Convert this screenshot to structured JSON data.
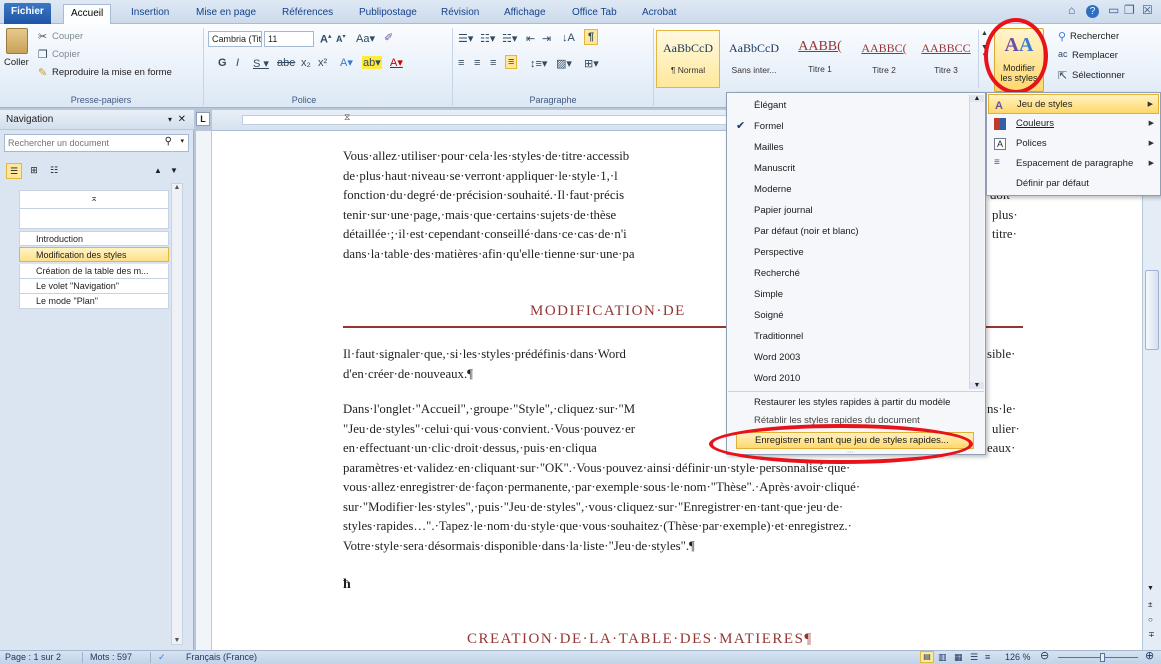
{
  "tabs": [
    "Fichier",
    "Accueil",
    "Insertion",
    "Mise en page",
    "Références",
    "Publipostage",
    "Révision",
    "Affichage",
    "Office Tab",
    "Acrobat"
  ],
  "clipboard": {
    "paste": "Coller",
    "cut": "Couper",
    "copy": "Copier",
    "format_painter": "Reproduire la mise en forme",
    "label": "Presse-papiers"
  },
  "font": {
    "name": "Cambria (Titre",
    "size": "11",
    "label": "Police"
  },
  "paragraph": {
    "label": "Paragraphe"
  },
  "styles": {
    "items": [
      {
        "preview": "AaBbCcD",
        "name": "¶ Normal"
      },
      {
        "preview": "AaBbCcD",
        "name": "Sans inter..."
      },
      {
        "preview": "AABB(",
        "name": "Titre 1"
      },
      {
        "preview": "AABBC(",
        "name": "Titre 2"
      },
      {
        "preview": "AABBCC",
        "name": "Titre 3"
      }
    ],
    "modify_line1": "Modifier",
    "modify_line2": "les styles"
  },
  "editing": {
    "find": "Rechercher",
    "replace": "Remplacer",
    "select": "Sélectionner"
  },
  "navigation": {
    "title": "Navigation",
    "search_placeholder": "Rechercher un document",
    "items": [
      "Introduction",
      "Modification des styles",
      "Création de la table des m...",
      "Le volet \"Navigation\"",
      "Le mode \"Plan\""
    ]
  },
  "document": {
    "para1": [
      "Vous·allez·utiliser·pour·cela·les·styles·de·titre·accessib",
      "de·plus·haut·niveau·se·verront·appliquer·le·style·1,·l",
      "fonction·du·degré·de·précision·souhaité.·Il·faut·précis",
      "tenir·sur·une·page,·mais·que·certains·sujets·de·thèse",
      "détaillée·;·il·est·cependant·conseillé·dans·ce·cas·de·n'i",
      "dans·la·table·des·matières·afin·qu'elle·tienne·sur·une·pa"
    ],
    "para1_right": [
      "doit·",
      "plus·",
      "titre·"
    ],
    "heading1": "MODIFICATION·DE",
    "para2": [
      "Il·faut·signaler·que,·si·les·styles·prédéfinis·dans·Word",
      "d'en·créer·de·nouveaux.¶"
    ],
    "para2_right": "sible·",
    "para3": [
      "Dans·l'onglet·\"Accueil\",·groupe·\"Style\",·cliquez·sur·\"M",
      "\"Jeu·de·styles\"·celui·qui·vous·convient.·Vous·pouvez·er",
      "en·effectuant·un·clic·droit·dessus,·puis·en·cliqua",
      "paramètres·et·validez·en·cliquant·sur·\"OK\".·Vous·pouvez·ainsi·définir·un·style·personnalisé·que·",
      "vous·allez·enregistrer·de·façon·permanente,·par·exemple·sous·le·nom·\"Thèse\".·Après·avoir·cliqué·",
      "sur·\"Modifier·les·styles\",·puis·\"Jeu·de·styles\",·vous·cliquez·sur·\"Enregistrer·en·tant·que·jeu·de·",
      "styles·rapides…\".·Tapez·le·nom·du·style·que·vous·souhaitez·(Thèse·par·exemple)·et·enregistrez.·",
      "Votre·style·sera·désormais·disponible·dans·la·liste·\"Jeu·de·styles\".¶"
    ],
    "para3_right": [
      "ns·le·",
      "ulier·",
      "eaux·"
    ],
    "heading2": "CREATION·DE·LA·TABLE·DES·MATIERES¶"
  },
  "style_sets_menu": {
    "items": [
      "Élégant",
      "Formel",
      "Mailles",
      "Manuscrit",
      "Moderne",
      "Papier journal",
      "Par défaut (noir et blanc)",
      "Perspective",
      "Recherché",
      "Simple",
      "Soigné",
      "Traditionnel",
      "Word 2003",
      "Word 2010"
    ],
    "checked": "Formel",
    "restore": "Restaurer les styles rapides à partir du modèle",
    "reset": "Rétablir les styles rapides du document",
    "save": "Enregistrer en tant que jeu de styles rapides..."
  },
  "modify_submenu": {
    "items": [
      "Jeu de styles",
      "Couleurs",
      "Polices",
      "Espacement de paragraphe",
      "Définir par défaut"
    ]
  },
  "status": {
    "page": "Page : 1 sur 2",
    "words": "Mots : 597",
    "language": "Français (France)",
    "zoom": "126 %"
  },
  "colors": {
    "accent": "#943634",
    "highlight": "#ffe08a",
    "annotation": "#e8121a"
  }
}
